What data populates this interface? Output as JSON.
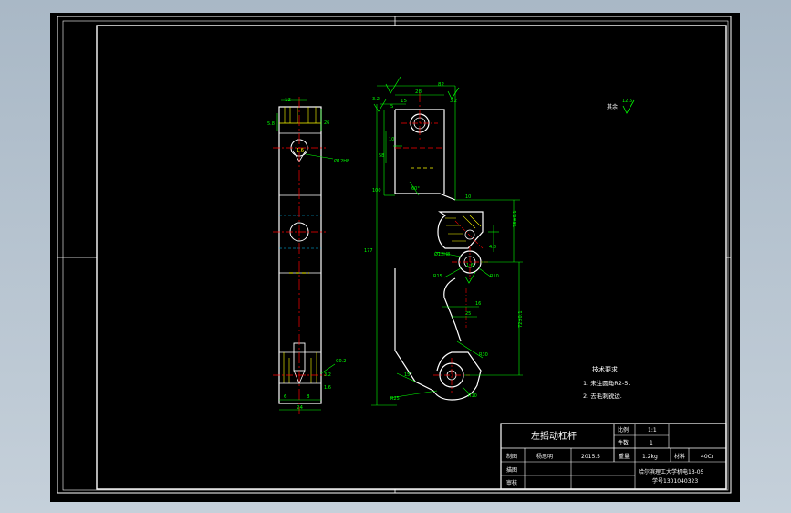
{
  "colors": {
    "background": "#000000",
    "frame": "#ffffff",
    "dimension": "#00ff00",
    "centerline": "#ff0000",
    "hatch": "#ffff00",
    "hidden": "#00c8ff"
  },
  "left_view": {
    "dims": {
      "top_width": "12",
      "side_a": "5.8",
      "side_b": "26",
      "bore_note": "Ø12H8",
      "bottom_width": "6",
      "bottom_depth": "8",
      "overall": "24",
      "chamfer": "C0.2",
      "rough_a": "1.6",
      "rough_b": "3.2",
      "rough_c": "1.6"
    }
  },
  "main_view": {
    "dims": {
      "top_overall": "82",
      "top_28": "28",
      "top_15": "15",
      "top_5": "5",
      "rough_top": "3.2",
      "rough_right": "3.2",
      "v10": "10",
      "v58": "58",
      "v100": "100",
      "v177": "177",
      "angle": "60°",
      "r10": "10",
      "hole": "Ø12H8",
      "hole_depth": "4.8",
      "r15": "R15",
      "r10b": "R10",
      "rough_mid": "1.6",
      "h16": "16",
      "h25": "25",
      "r30": "R30",
      "r25": "R25",
      "angle_b": "15°",
      "r10c": "R10",
      "right_a": "78±0.1",
      "right_b": "72±0.1"
    }
  },
  "surface_finish": {
    "label": "其余",
    "value": "12.5"
  },
  "tech_req": {
    "title": "技术要求",
    "items": [
      "1. 未注圆角R2-5.",
      "2. 去毛刺锐边."
    ]
  },
  "title_block": {
    "part_name": "左摇动杠杆",
    "scale_label": "比例",
    "scale_value": "1:1",
    "qty_label": "件数",
    "qty_value": "1",
    "drawn_label": "制图",
    "drawn_name": "杨思明",
    "drawn_date": "2015.5",
    "weight_label": "重量",
    "weight_value": "1.2kg",
    "material_label": "材料",
    "material_value": "40Cr",
    "check_label": "描图",
    "review_label": "审核",
    "school": "哈尔滨理工大学机电13-05",
    "student_id": "学号1301040323"
  }
}
